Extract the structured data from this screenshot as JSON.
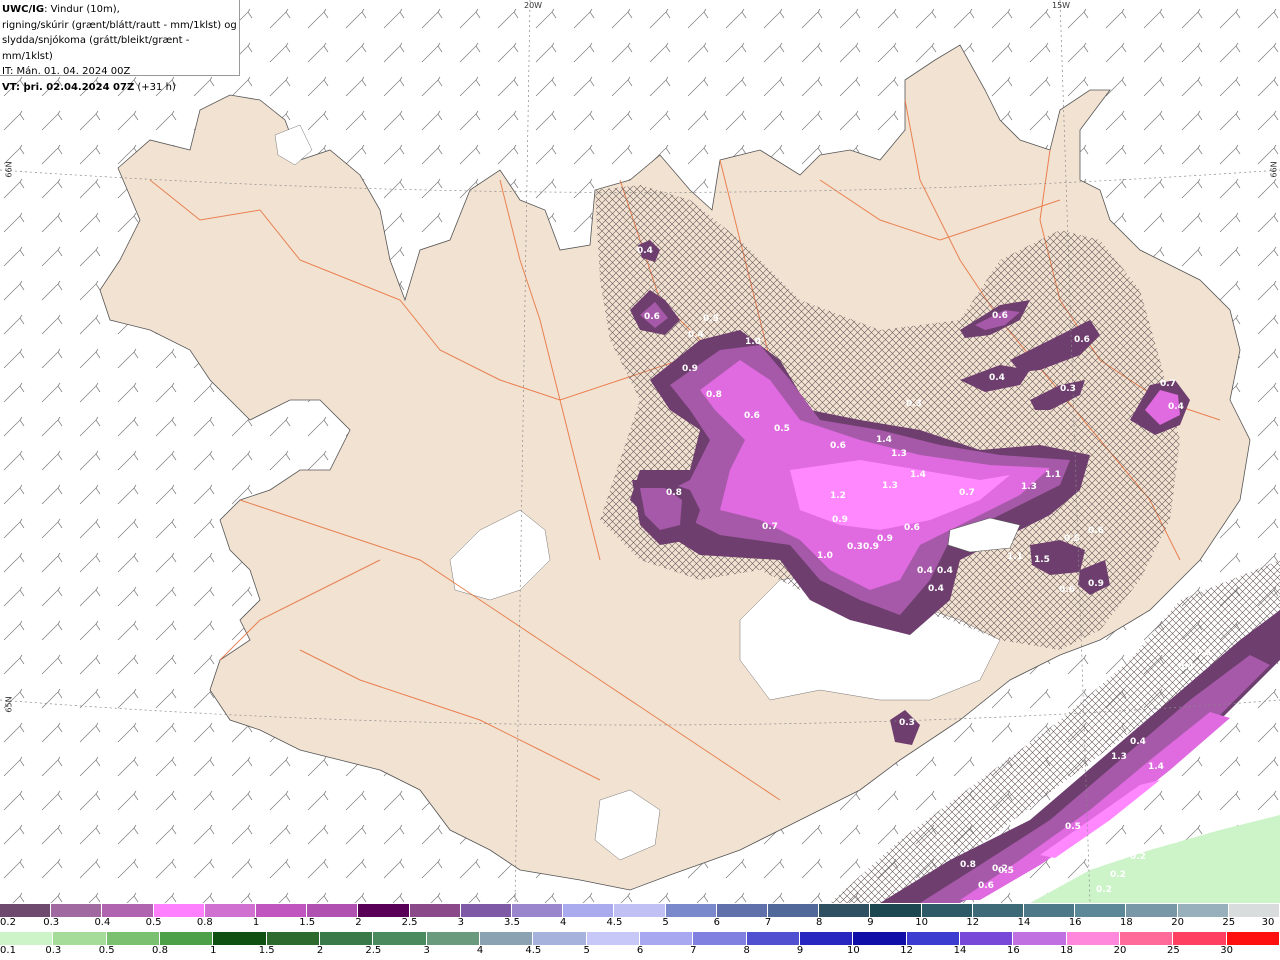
{
  "title": {
    "model": "UWC/IG",
    "line1": ": Vindur (10m),",
    "line2": "rigning/skúrir (grænt/blátt/rautt - mm/1klst) og",
    "line3": "slydda/snjókoma (grátt/bleikt/grænt - mm/1klst)",
    "init": "IT: Mán. 01. 04. 2024 00Z",
    "valid_label": "VT: þri. 02.04.2024 07Z",
    "valid_offset": " (+31 h)"
  },
  "grid_labels": {
    "lon1": "20W",
    "lon2": "15W",
    "lat1": "66N",
    "lat1b": "66N",
    "lat2": "65N"
  },
  "map_colors": {
    "sea": "#ffffff",
    "land": "#f2e2d2",
    "roads": "#e8703a",
    "coast": "#555555",
    "ice": "#ffffff",
    "precip_low": "#6e3f6e",
    "precip_mid": "#a659a8",
    "precip_high": "#e06ae0",
    "precip_max": "#ff88ff",
    "rain_light": "#bdf0b8"
  },
  "value_labels": [
    "0.4",
    "0.6",
    "0.5",
    "0.4",
    "1.0",
    "0.9",
    "0.8",
    "0.6",
    "0.5",
    "0.6",
    "1.4",
    "1.3",
    "1.4",
    "1.3",
    "1.2",
    "0.9",
    "0.8",
    "0.7",
    "0.6",
    "0.6",
    "1.1",
    "1.3",
    "1.1",
    "0.7",
    "1.0",
    "0.30.9",
    "0.9",
    "0.4",
    "0.4",
    "0.4",
    "1.1",
    "1.5",
    "0.5",
    "0.6",
    "0.4",
    "0.3",
    "0.3",
    "0.6",
    "0.6",
    "0.4",
    "0.7",
    "0.9",
    "0.3",
    "0.6",
    "0.4",
    "0.4",
    "1.3",
    "1.4",
    "0.4",
    "0.2",
    "0.2",
    "0.5",
    "0.2",
    "0.2",
    "0.2",
    "0.2",
    "0.8",
    "0.6",
    "0.5"
  ],
  "legend_snow": {
    "labels": [
      "0.2",
      "0.3",
      "0.4",
      "0.5",
      "0.8",
      "1",
      "1.5",
      "2",
      "2.5",
      "3",
      "3.5",
      "4",
      "4.5",
      "5",
      "6",
      "7",
      "8",
      "9",
      "10",
      "12",
      "14",
      "16",
      "18",
      "20",
      "25",
      "30"
    ],
    "colors": [
      "#6e4a6e",
      "#a06aa0",
      "#b064b0",
      "#ff80ff",
      "#d070d0",
      "#c055c0",
      "#b050b0",
      "#580058",
      "#8a4a8a",
      "#7e5aa6",
      "#9a86cc",
      "#aaaaee",
      "#c0c0f4",
      "#7a88cc",
      "#6070aa",
      "#50689a",
      "#2e5060",
      "#1c4650",
      "#2e5a68",
      "#3e6a78",
      "#4c7888",
      "#5c8898",
      "#7898a8",
      "#98b0bc",
      "#d8dcdc"
    ]
  },
  "legend_rain": {
    "labels": [
      "0.1",
      "0.3",
      "0.5",
      "0.8",
      "1",
      "1.5",
      "2",
      "2.5",
      "3",
      "4",
      "4.5",
      "5",
      "6",
      "7",
      "8",
      "9",
      "10",
      "12",
      "14",
      "16",
      "18",
      "20",
      "25",
      "30"
    ],
    "colors": [
      "#ccf4c8",
      "#a6dc9a",
      "#7ac070",
      "#4ea048",
      "#105010",
      "#2e6a2e",
      "#3a7a4a",
      "#4a8a5e",
      "#6a9a7e",
      "#8aa2b2",
      "#a6b2dc",
      "#c8c8f8",
      "#a8a8f0",
      "#8080e0",
      "#5050d0",
      "#2828c0",
      "#1010a8",
      "#3c3cd0",
      "#7848d8",
      "#c070e0",
      "#ff88dd",
      "#ff6a9a",
      "#ff4060",
      "#ff1010"
    ]
  }
}
